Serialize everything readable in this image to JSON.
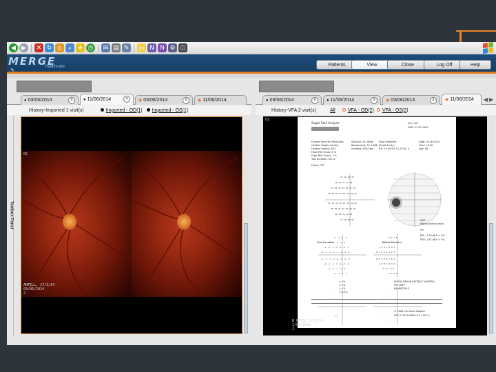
{
  "browser_toolbar": {
    "icons": [
      "back-icon",
      "forward-icon",
      "stop-icon",
      "refresh-icon",
      "home-icon",
      "search-icon",
      "favorites-icon",
      "history-icon",
      "mail-icon",
      "print-icon",
      "edit-icon",
      "messenger-icon",
      "research-icon",
      "note-icon",
      "tool-icon",
      "screenshot-icon"
    ]
  },
  "header": {
    "logo": "MERGE",
    "logo_sub": "Healthcare",
    "buttons": {
      "patients": "Patients",
      "view": "View",
      "close": "Close",
      "logoff": "Log Off",
      "help": "Help"
    },
    "accent_color": "#e37b1c",
    "brand_color": "#1e4d7b"
  },
  "left_panel": {
    "tabs": [
      {
        "label": "03/06/2014"
      },
      {
        "label": "11/06/2014"
      },
      {
        "label": "03/06/2014"
      },
      {
        "label": "11/06/2014"
      }
    ],
    "history_title": "History-Imported 1 visit(s)",
    "filters": [
      {
        "label": "Imported - OD(1)"
      },
      {
        "label": "Imported - OS(1)"
      }
    ],
    "toolbox_label": "Toolbox Panel",
    "image": {
      "eye_label": "OS",
      "footer_line1": "ANTELL, 17/3/14",
      "footer_line2": "03/06/2014",
      "footer_line3": "2"
    }
  },
  "right_panel": {
    "tabs": [
      {
        "label": "03/06/2014"
      },
      {
        "label": "11/06/2014"
      },
      {
        "label": "03/06/2014"
      },
      {
        "label": "11/06/2014"
      }
    ],
    "history_title": "History-VFA 2 visit(s)",
    "filters": [
      {
        "label": "All"
      },
      {
        "label": "VFA - OD(2)"
      },
      {
        "label": "VFA - OS(2)"
      }
    ],
    "image": {
      "corner_label": "OS",
      "footer_line1": "N PITEL 17/3/14",
      "footer_line2": "1/06/2014",
      "footer_line3": "1",
      "report": {
        "title": "Single Field Analysis",
        "eye": "Eye: Left",
        "dob": "DOB: 21-07-1967",
        "left_col": [
          "Fixation Monitor: Blind Spot",
          "Fixation Target: Central",
          "Fixation Losses: 0/13",
          "False POS Errors: 0 %",
          "False NEG Errors: 1 %",
          "Test Duration: 03:11",
          "Fovea: OFF"
        ],
        "mid_col": [
          "Stimulus: III, White",
          "Background: 31.5 ASB",
          "Strategy: SITA-Fast"
        ],
        "mid_col2": [
          "Pupil Diameter:",
          "Visual Acuity:",
          "RX: +3.00 DS +1.25 DC X"
        ],
        "right_col": [
          "Date: 03-06-2014",
          "Time: 10:00",
          "Age: 46"
        ],
        "ght_label": "GHT",
        "ght_value": "Within normal limits",
        "vfi": "VFI",
        "md": "MD:  -1.78 dB  P < 5%",
        "psd": "PSD:  1.87 dB  P < 5%",
        "total_dev": "Total Deviation",
        "pattern_dev": "Pattern Deviation",
        "legend": [
          "< 5%",
          "< 2%",
          "< 1%",
          "< 0.5%"
        ],
        "hospital": [
          "NORTH DEVON DISTRICT HOSPITAL",
          "EYE DEPT",
          "BARNSTAPLE"
        ],
        "copyright": "© 2006 Carl Zeiss Meditec",
        "version": "HFA II 750-10098-16.2 / 16.2.1"
      }
    }
  }
}
